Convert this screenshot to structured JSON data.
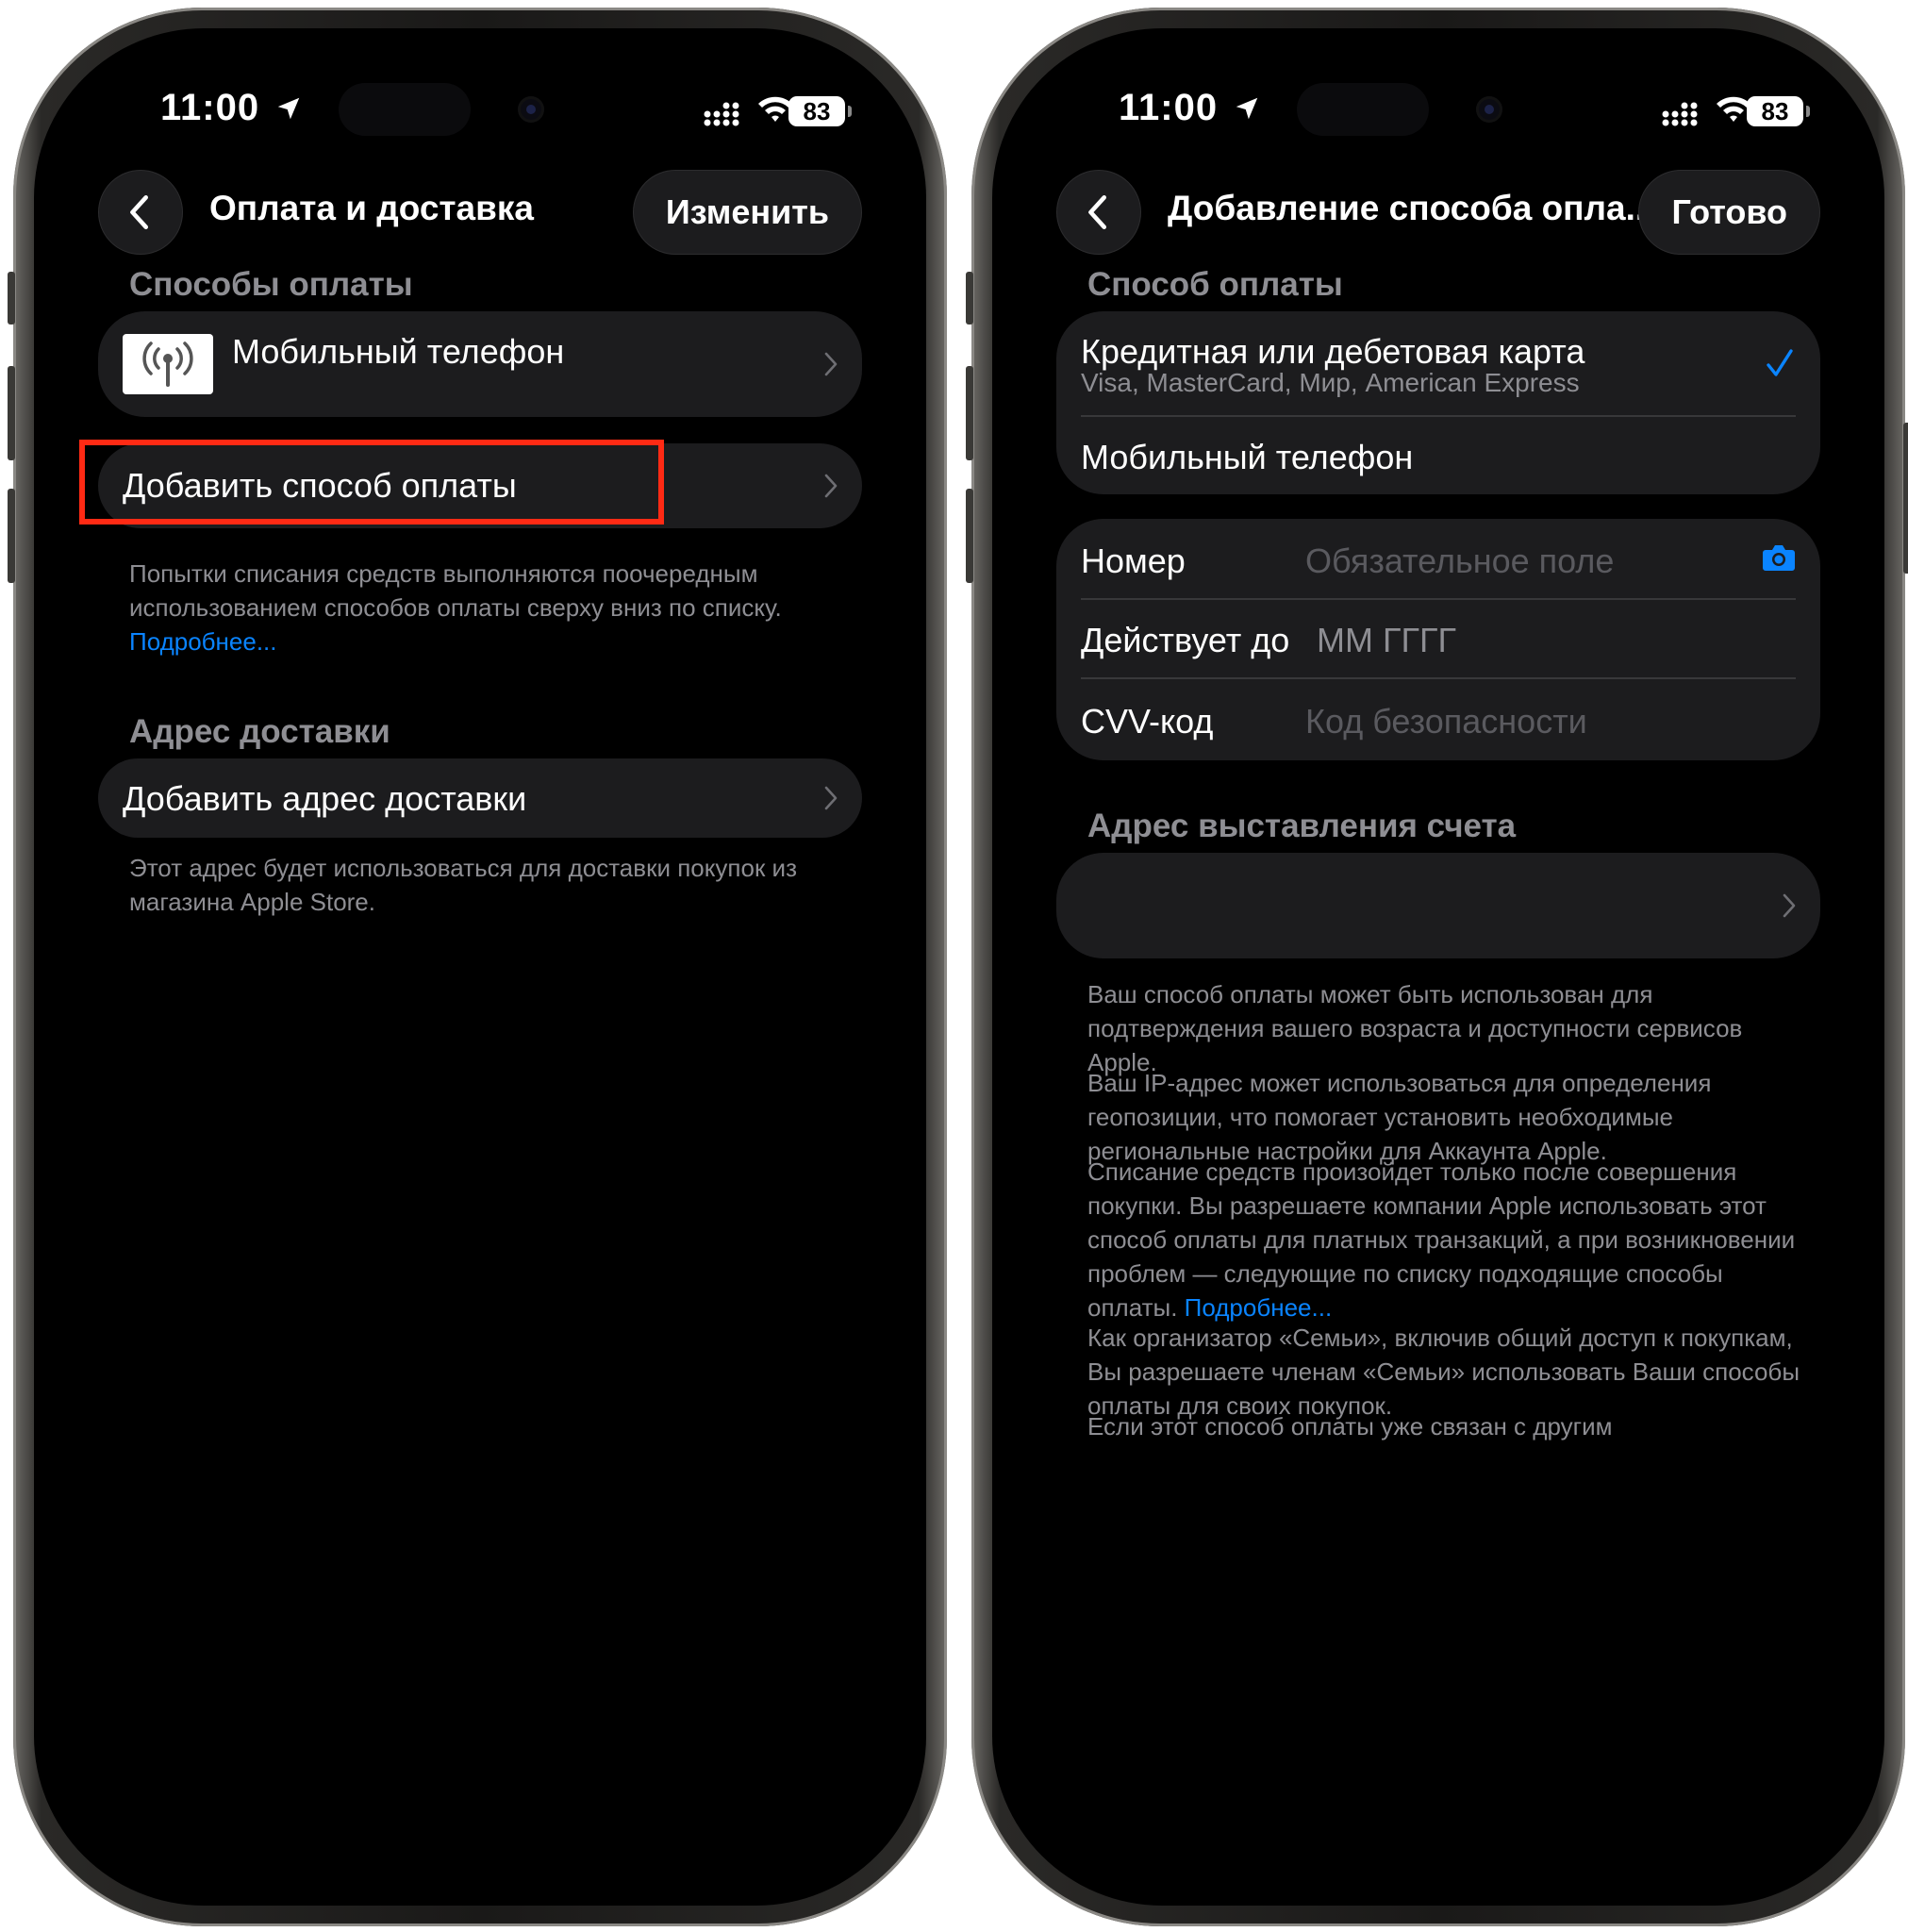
{
  "status": {
    "time": "11:00",
    "battery": "83"
  },
  "left": {
    "title": "Оплата и доставка",
    "edit_label": "Изменить",
    "payment_section": "Способы оплаты",
    "payment_item": "Мобильный телефон",
    "add_payment": "Добавить способ оплаты",
    "payment_footer": "Попытки списания средств выполняются поочередным использованием способов оплаты сверху вниз по списку. ",
    "payment_footer_link": "Подробнее...",
    "shipping_section": "Адрес доставки",
    "add_shipping": "Добавить адрес доставки",
    "shipping_footer": "Этот адрес будет использоваться для доставки покупок из магазина Apple Store."
  },
  "right": {
    "title": "Добавление способа опла...",
    "done_label": "Готово",
    "method_section": "Способ оплаты",
    "options": [
      {
        "label": "Кредитная или дебетовая карта",
        "sub": "Visa, MasterCard, Мир, American Express",
        "selected": true
      },
      {
        "label": "Мобильный телефон",
        "selected": false
      }
    ],
    "fields": {
      "number_label": "Номер",
      "number_placeholder": "Обязательное поле",
      "expiry_label": "Действует до",
      "expiry_value": "ММ ГГГГ",
      "cvv_label": "CVV-код",
      "cvv_placeholder": "Код безопасности"
    },
    "billing_section": "Адрес выставления счета",
    "paragraphs": [
      "Ваш способ оплаты может быть использован для подтверждения вашего возраста и доступности сервисов Apple.",
      "Ваш IP-адрес может использоваться для определения геопозиции, что помогает установить необходимые региональные настройки для Аккаунта Apple.",
      "Списание средств произойдет только после совершения покупки. Вы разрешаете компании Apple использовать этот способ оплаты для платных транзакций, а при возникновении проблем — следующие по списку подходящие способы оплаты. ",
      "Подробнее...",
      "Как организатор «Семьи», включив общий доступ к покупкам, Вы разрешаете членам «Семьи» использовать Ваши способы оплаты для своих покупок.",
      "Если этот способ оплаты уже связан с другим"
    ]
  },
  "colors": {
    "accent": "#0a84ff",
    "highlight": "#ff2a14",
    "card": "#1c1c1e"
  },
  "icons": [
    "location-arrow-icon",
    "cellular-signal-icon",
    "wifi-icon",
    "battery-icon",
    "back-chevron-icon",
    "chevron-right-icon",
    "mobile-antenna-icon",
    "checkmark-icon",
    "camera-icon"
  ]
}
